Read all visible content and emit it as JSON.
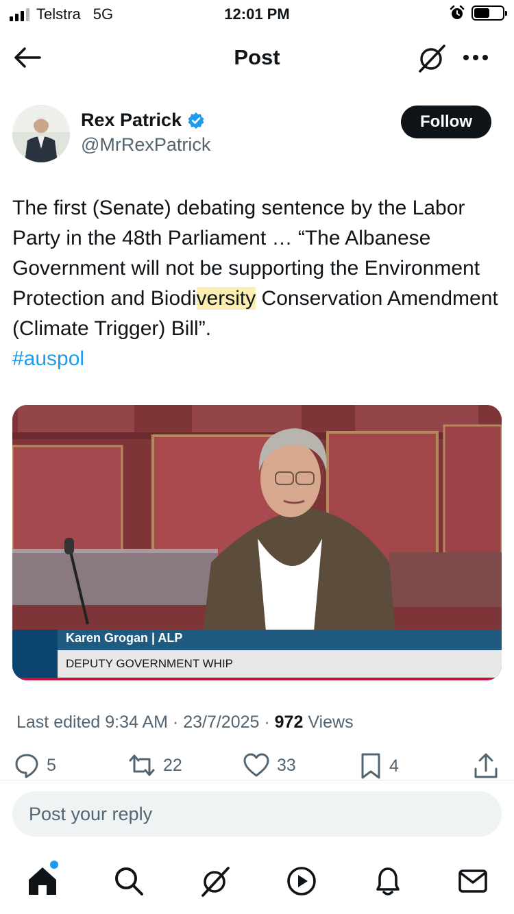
{
  "status_bar": {
    "carrier": "Telstra",
    "network": "5G",
    "time": "12:01 PM",
    "battery_level": 0.55
  },
  "header": {
    "title": "Post",
    "back_icon": "arrow-left-icon",
    "grok_icon": "grok-icon",
    "more_icon": "more-horizontal-icon"
  },
  "author": {
    "name": "Rex Patrick",
    "handle": "@MrRexPatrick",
    "verified": true,
    "follow_label": "Follow"
  },
  "post": {
    "text_before": "The first (Senate) debating sentence by the Labor Party in the 48th Parliament … “The Albanese Government will not be supporting the Environment Protection and Biodi",
    "text_highlight": "versity",
    "text_after": " Conservation Amendment (Climate Trigger) Bill”.",
    "hashtag": "#auspol"
  },
  "media": {
    "lower_third_name": "Karen Grogan | ALP",
    "lower_third_title": "DEPUTY GOVERNMENT WHIP"
  },
  "meta": {
    "edited": "Last edited 9:34 AM · 23/7/2025",
    "views_count": "972",
    "views_label": "Views"
  },
  "actions": {
    "replies": "5",
    "reposts": "22",
    "likes": "33",
    "bookmarks": "4"
  },
  "reply": {
    "placeholder": "Post your reply"
  },
  "colors": {
    "accent": "#1d9bf0",
    "text": "#0f1419",
    "secondary": "#536471"
  },
  "tabbar": {
    "items": [
      "home-icon",
      "search-icon",
      "grok-icon",
      "video-icon",
      "notifications-icon",
      "messages-icon"
    ]
  }
}
